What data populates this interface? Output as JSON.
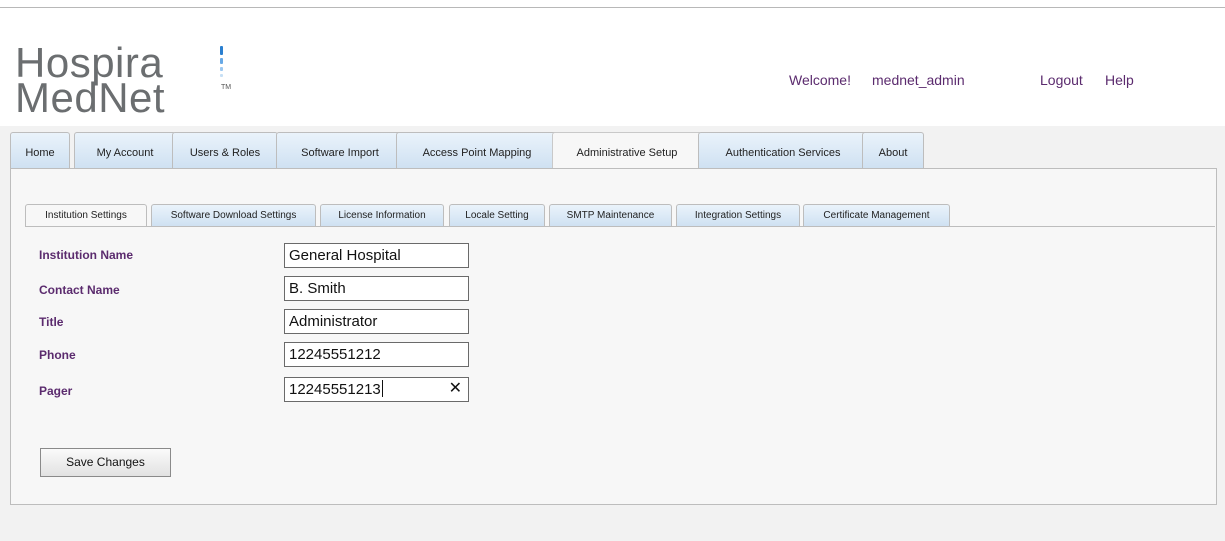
{
  "header": {
    "logo_line1": "Hospira",
    "logo_line2": "MedNet",
    "logo_tm": "TM",
    "welcome_label": "Welcome!",
    "username": "mednet_admin",
    "logout_label": "Logout",
    "help_label": "Help",
    "brand_color": "#5b2b6e"
  },
  "main_tabs": [
    {
      "label": "Home"
    },
    {
      "label": "My Account"
    },
    {
      "label": "Users & Roles"
    },
    {
      "label": "Software Import"
    },
    {
      "label": "Access Point Mapping"
    },
    {
      "label": "Administrative Setup",
      "active": true
    },
    {
      "label": "Authentication Services"
    },
    {
      "label": "About"
    }
  ],
  "sub_tabs": [
    {
      "label": "Institution Settings",
      "active": true
    },
    {
      "label": "Software Download Settings"
    },
    {
      "label": "License Information"
    },
    {
      "label": "Locale Setting"
    },
    {
      "label": "SMTP Maintenance"
    },
    {
      "label": "Integration Settings"
    },
    {
      "label": "Certificate Management"
    }
  ],
  "form": {
    "institution_name": {
      "label": "Institution Name",
      "value": "General Hospital"
    },
    "contact_name": {
      "label": "Contact Name",
      "value": "B. Smith"
    },
    "title": {
      "label": "Title",
      "value": "Administrator"
    },
    "phone": {
      "label": "Phone",
      "value": "12245551212"
    },
    "pager": {
      "label": "Pager",
      "value": "12245551213",
      "clear_icon": "close-icon"
    },
    "save_label": "Save Changes"
  }
}
